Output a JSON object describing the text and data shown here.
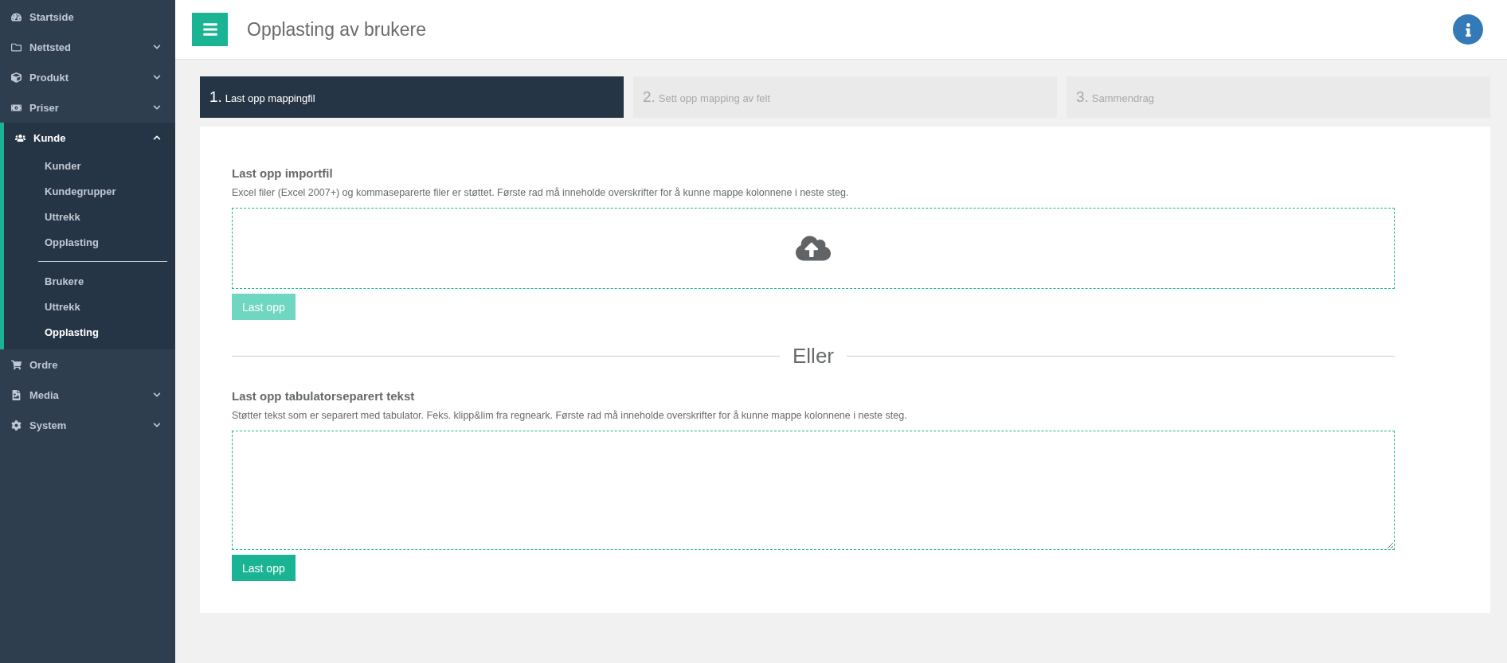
{
  "sidebar": {
    "items": [
      {
        "label": "Startside",
        "kind": "link"
      },
      {
        "label": "Nettsted",
        "kind": "menu",
        "expanded": false
      },
      {
        "label": "Produkt",
        "kind": "menu",
        "expanded": false
      },
      {
        "label": "Priser",
        "kind": "menu",
        "expanded": false
      },
      {
        "label": "Kunde",
        "kind": "menu",
        "expanded": true,
        "children": [
          [
            {
              "label": "Kunder",
              "selected": false
            },
            {
              "label": "Kundegrupper",
              "selected": false
            },
            {
              "label": "Uttrekk",
              "selected": false
            },
            {
              "label": "Opplasting",
              "selected": false
            }
          ],
          [
            {
              "label": "Brukere",
              "selected": false
            },
            {
              "label": "Uttrekk",
              "selected": false
            },
            {
              "label": "Opplasting",
              "selected": true
            }
          ]
        ]
      },
      {
        "label": "Ordre",
        "kind": "link"
      },
      {
        "label": "Media",
        "kind": "menu",
        "expanded": false
      },
      {
        "label": "System",
        "kind": "menu",
        "expanded": false
      }
    ]
  },
  "header": {
    "title": "Opplasting av brukere"
  },
  "steps": [
    {
      "number": "1.",
      "label": "Last opp mappingfil",
      "selected": true
    },
    {
      "number": "2.",
      "label": "Sett opp mapping av felt",
      "selected": false
    },
    {
      "number": "3.",
      "label": "Sammendrag",
      "selected": false
    }
  ],
  "file_upload": {
    "title": "Last opp importfil",
    "description": "Excel filer (Excel 2007+) og kommaseparerte filer er støttet. Første rad må inneholde overskrifter for å kunne mappe kolonnene i neste steg.",
    "button": {
      "label": "Last opp",
      "disabled": true
    }
  },
  "separator": "Eller",
  "text_upload": {
    "title": "Last opp tabulatorseparert tekst",
    "description": "Støtter tekst som er separert med tabulator. Feks. klipp&lim fra regneark. Første rad må inneholde overskrifter for å kunne mappe kolonnene i neste steg.",
    "button": {
      "label": "Last opp",
      "disabled": false
    }
  }
}
